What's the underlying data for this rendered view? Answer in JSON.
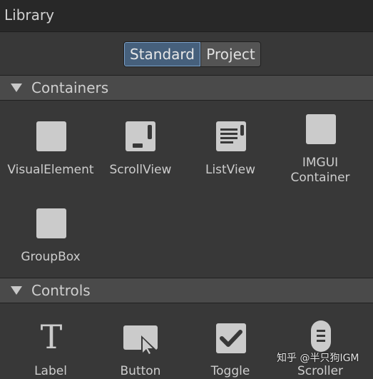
{
  "window": {
    "title": "Library"
  },
  "toggle": {
    "standard": "Standard",
    "project": "Project"
  },
  "sections": [
    {
      "label": "Containers"
    },
    {
      "label": "Controls"
    }
  ],
  "containers": [
    {
      "label": "VisualElement",
      "icon": "visual-element-icon"
    },
    {
      "label": "ScrollView",
      "icon": "scroll-view-icon"
    },
    {
      "label": "ListView",
      "icon": "list-view-icon"
    },
    {
      "label": "IMGUI\nContainer",
      "icon": "imgui-container-icon"
    },
    {
      "label": "GroupBox",
      "icon": "group-box-icon"
    }
  ],
  "controls": [
    {
      "label": "Label",
      "icon": "label-icon"
    },
    {
      "label": "Button",
      "icon": "button-icon"
    },
    {
      "label": "Toggle",
      "icon": "toggle-icon"
    },
    {
      "label": "Scroller",
      "icon": "scroller-icon"
    }
  ],
  "watermark": "知乎 @半只狗IGM"
}
